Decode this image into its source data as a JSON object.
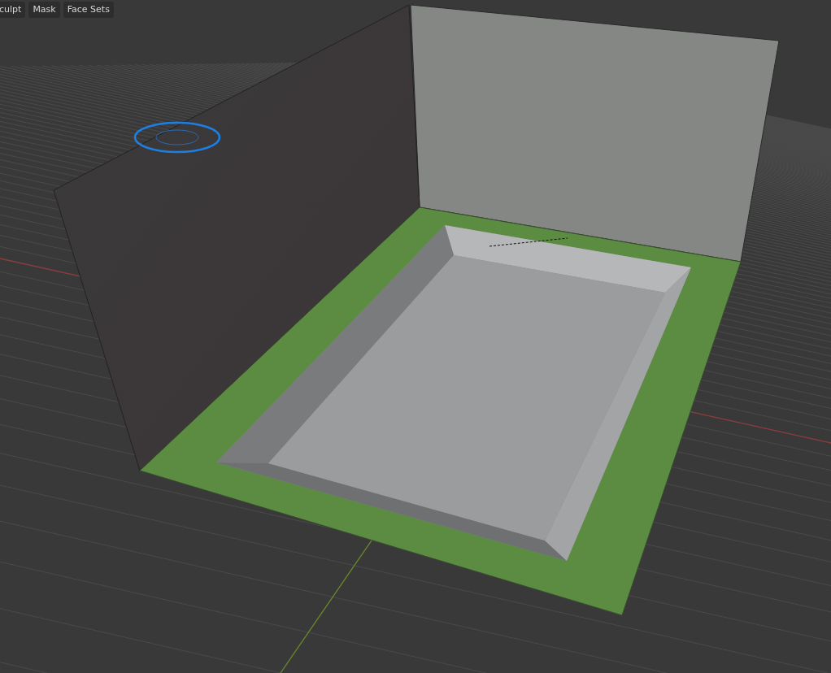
{
  "header_menu": [
    "culpt",
    "Mask",
    "Face Sets"
  ]
}
